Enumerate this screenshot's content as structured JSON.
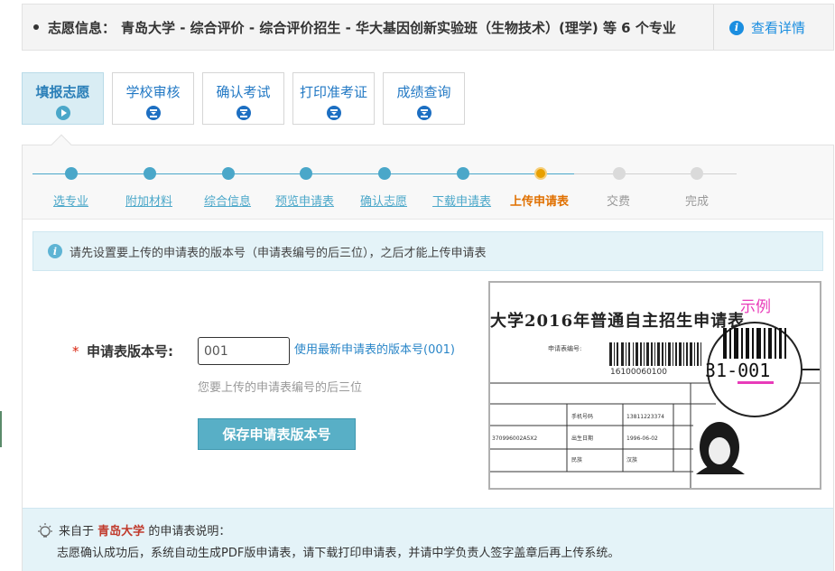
{
  "info_bar": {
    "label": "志愿信息：",
    "programs": "青岛大学 - 综合评价 - 综合评价招生 - 华大基因创新实验班（生物技术）(理学) 等 6 个专业",
    "detail_link": "查看详情",
    "detail_icon": "info-icon"
  },
  "tabs": [
    {
      "label": "填报志愿",
      "icon": "play-icon",
      "active": true
    },
    {
      "label": "学校审核",
      "icon": "hourglass-icon",
      "active": false
    },
    {
      "label": "确认考试",
      "icon": "hourglass-icon",
      "active": false
    },
    {
      "label": "打印准考证",
      "icon": "hourglass-icon",
      "active": false
    },
    {
      "label": "成绩查询",
      "icon": "hourglass-icon",
      "active": false
    }
  ],
  "steps": [
    {
      "label": "选专业",
      "state": "done"
    },
    {
      "label": "附加材料",
      "state": "done"
    },
    {
      "label": "综合信息",
      "state": "done"
    },
    {
      "label": "预览申请表",
      "state": "done"
    },
    {
      "label": "确认志愿",
      "state": "done"
    },
    {
      "label": "下载申请表",
      "state": "done"
    },
    {
      "label": "上传申请表",
      "state": "current"
    },
    {
      "label": "交费",
      "state": "todo"
    },
    {
      "label": "完成",
      "state": "todo"
    }
  ],
  "notice": {
    "text": "请先设置要上传的申请表的版本号（申请表编号的后三位），之后才能上传申请表"
  },
  "form": {
    "required_mark": "*",
    "label": "申请表版本号:",
    "input_value": "001",
    "use_latest_link": "使用最新申请表的版本号(001)",
    "hint": "您要上传的申请表编号的后三位",
    "save_button": "保存申请表版本号"
  },
  "sample": {
    "caption": "示例",
    "form_title": "大学2016年普通自主招生申请表",
    "field_label": "申请表编号:",
    "barcode_number": "16100060100",
    "magnified_code": "31-001",
    "table_cells": [
      "手机号码",
      "13811223374",
      "出生日期",
      "1996-06-02",
      "民族",
      "汉族",
      "370996002A5X2"
    ]
  },
  "footer": {
    "from_prefix": "来自于",
    "school": "青岛大学",
    "from_suffix": "的申请表说明：",
    "instruction": "志愿确认成功后，系统自动生成PDF版申请表，请下载打印申请表，并请中学负责人签字盖章后再上传系统。",
    "icon": "lightbulb-icon"
  },
  "colors": {
    "accent": "#4aa7c9",
    "link": "#2178c4",
    "current_step": "#e07000",
    "sample_caption": "#e83bb9",
    "school_highlight": "#c0392b"
  }
}
